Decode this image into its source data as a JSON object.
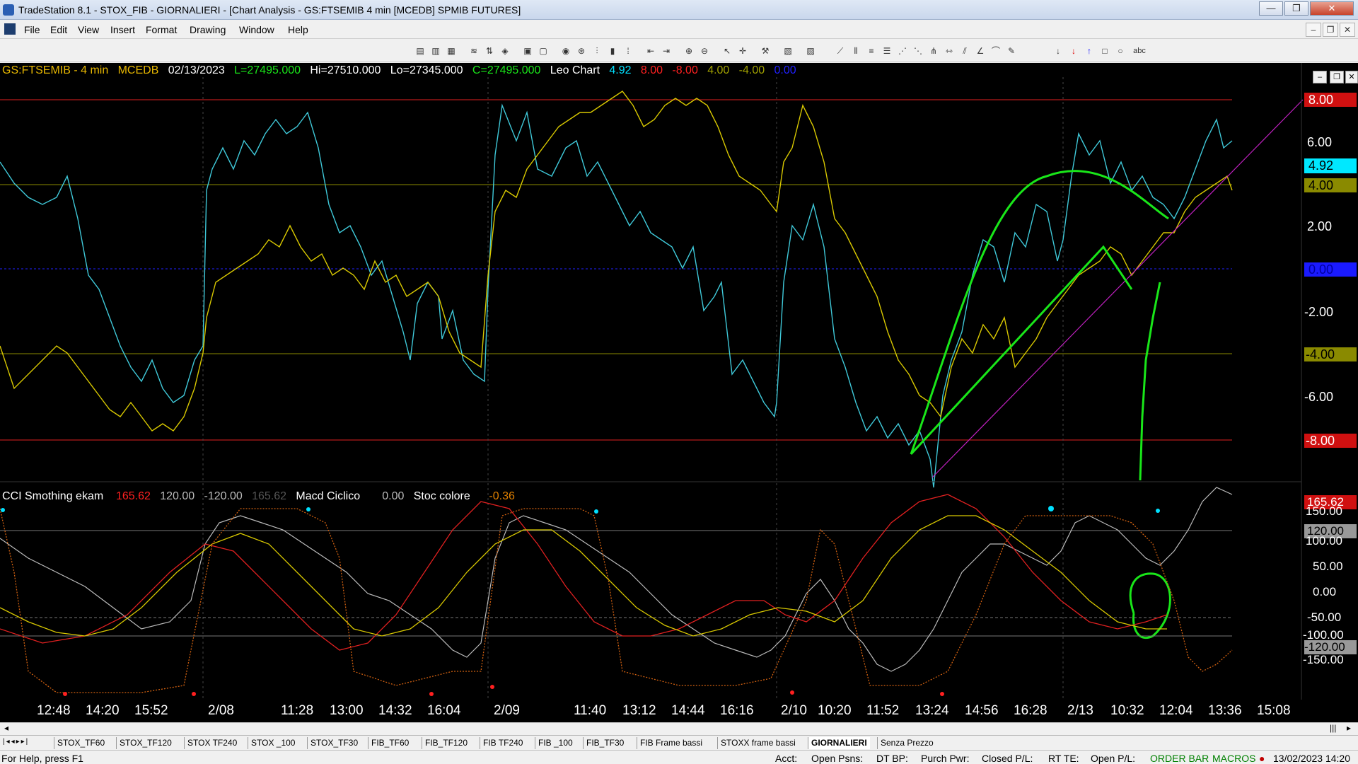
{
  "window": {
    "title": "TradeStation 8.1 - STOX_FIB - GIORNALIERI - [Chart Analysis - GS:FTSEMIB  4 min  [MCEDB] SPMIB FUTURES]",
    "controls": [
      "—",
      "❐",
      "✕"
    ]
  },
  "menu": {
    "items": [
      "File",
      "Edit",
      "View",
      "Insert",
      "Format",
      "Drawing",
      "Window",
      "Help"
    ]
  },
  "toolbar": {
    "abc_label": "abc"
  },
  "price_header": {
    "symbol": "GS:FTSEMIB - 4 min",
    "indicator": "MCEDB",
    "date": "02/13/2023",
    "last": "L=27495.000",
    "high": "Hi=27510.000",
    "low": "Lo=27345.000",
    "close": "C=27495.000",
    "study": "Leo Chart",
    "values": [
      {
        "text": "4.92",
        "color": "#00e0ff"
      },
      {
        "text": "8.00",
        "color": "#ff2020"
      },
      {
        "text": "-8.00",
        "color": "#ff2020"
      },
      {
        "text": "4.00",
        "color": "#a0a000"
      },
      {
        "text": "-4.00",
        "color": "#a0a000"
      },
      {
        "text": "0.00",
        "color": "#2020ff"
      }
    ]
  },
  "lower_header": {
    "study1": "CCI Smothing ekam",
    "v1": "165.62",
    "v2": "120.00",
    "v3": "-120.00",
    "v4": "165.62",
    "study2": "Macd Ciclico",
    "v5": "0.00",
    "study3": "Stoc colore",
    "v6": "-0.36"
  },
  "upper_axis": {
    "labels": [
      "8.00",
      "6.00",
      "4.92",
      "4.00",
      "2.00",
      "0.00",
      "-2.00",
      "-4.00",
      "-6.00",
      "-8.00"
    ]
  },
  "lower_axis": {
    "labels": [
      "165.62",
      "150.00",
      "120.00",
      "100.00",
      "50.00",
      "0.00",
      "-50.00",
      "-100.00",
      "-120.00",
      "-150.00"
    ]
  },
  "time_axis": {
    "labels": [
      "12:48",
      "14:20",
      "15:52",
      "2/08",
      "11:28",
      "13:00",
      "14:32",
      "16:04",
      "2/09",
      "11:40",
      "13:12",
      "14:44",
      "16:16",
      "2/10",
      "10:20",
      "11:52",
      "13:24",
      "14:56",
      "16:28",
      "2/13",
      "10:32",
      "12:04",
      "13:36",
      "15:08"
    ]
  },
  "sheet_tabs": [
    "STOX_TF60",
    "STOX_TF120",
    "STOX TF240",
    "STOX _100",
    "STOX_TF30",
    "FIB_TF60",
    "FIB_TF120",
    "FIB TF240",
    "FIB _100",
    "FIB_TF30",
    "FIB Frame bassi",
    "STOXX frame bassi",
    "GIORNALIERI",
    "Senza Prezzo"
  ],
  "active_tab": "GIORNALIERI",
  "status": {
    "help": "For Help, press F1",
    "acct": "Acct:",
    "open_psns": "Open Psns:",
    "dt_bp": "DT BP:",
    "purch_pwr": "Purch Pwr:",
    "closed_pl": "Closed P/L:",
    "rt_te": "RT TE:",
    "open_pl": "Open P/L:",
    "order_bar": "ORDER BAR",
    "macros": "MACROS",
    "datetime": "13/02/2023 14:20"
  },
  "colors": {
    "cyan": "#3fc8d8",
    "yellow": "#d8c800",
    "red": "#e02020",
    "green": "#19e619",
    "magenta": "#c020c0"
  }
}
